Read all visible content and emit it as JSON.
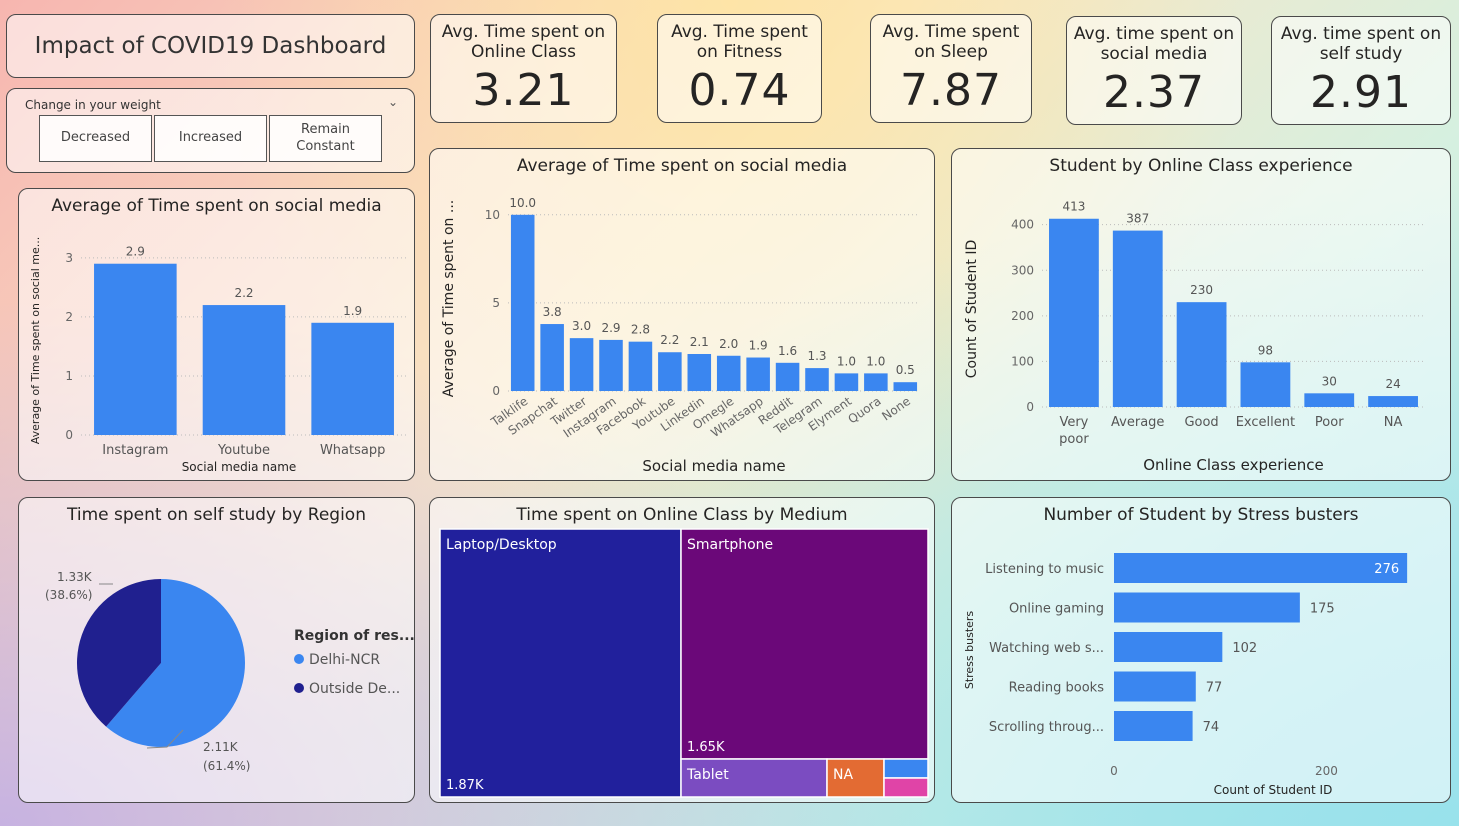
{
  "dashboard_title": "Impact of COVID19 Dashboard",
  "slicer": {
    "title": "Change in your weight",
    "options": [
      "Decreased",
      "Increased",
      "Remain Constant"
    ]
  },
  "cards": [
    {
      "label": "Avg. Time spent on Online Class",
      "value": "3.21"
    },
    {
      "label": "Avg. Time spent on Fitness",
      "value": "0.74"
    },
    {
      "label": "Avg. Time spent on Sleep",
      "value": "7.87"
    },
    {
      "label": "Avg. time spent on social media",
      "value": "2.37"
    },
    {
      "label": "Avg. time spent on self study",
      "value": "2.91"
    }
  ],
  "colors": {
    "bar": "#3A86F0",
    "pie_light": "#3A86F0",
    "pie_dark": "#20208F",
    "laptop": "#21209C",
    "smartphone": "#6B0879",
    "tablet": "#7B4CC1",
    "na": "#E36B33",
    "other1": "#3A86F0",
    "other2": "#E044A7"
  },
  "chart_data": [
    {
      "type": "bar",
      "title": "Average of Time spent on social media",
      "xlabel": "Social media name",
      "ylabel": "Average of Time spent on social me...",
      "categories": [
        "Instagram",
        "Youtube",
        "Whatsapp"
      ],
      "values": [
        2.9,
        2.2,
        1.9
      ],
      "data_labels": [
        "2.9",
        "2.2",
        "1.9"
      ],
      "yticks": [
        "0",
        "1",
        "2",
        "3"
      ],
      "ylim": [
        0,
        3.2
      ],
      "grid": true
    },
    {
      "type": "bar",
      "title": "Average of Time spent on social media",
      "xlabel": "Social media name",
      "ylabel": "Average of Time spent on ...",
      "categories": [
        "Talklife",
        "Snapchat",
        "Twitter",
        "Instagram",
        "Facebook",
        "Youtube",
        "Linkedin",
        "Omegle",
        "Whatsapp",
        "Reddit",
        "Telegram",
        "Elyment",
        "Quora",
        "None"
      ],
      "values": [
        10.0,
        3.8,
        3.0,
        2.9,
        2.8,
        2.2,
        2.1,
        2.0,
        1.9,
        1.6,
        1.3,
        1.0,
        1.0,
        0.5
      ],
      "data_labels": [
        "10.0",
        "3.8",
        "3.0",
        "2.9",
        "2.8",
        "2.2",
        "2.1",
        "2.0",
        "1.9",
        "1.6",
        "1.3",
        "1.0",
        "1.0",
        "0.5"
      ],
      "yticks": [
        "0",
        "5",
        "10"
      ],
      "ylim": [
        0,
        10.5
      ],
      "grid": true
    },
    {
      "type": "bar",
      "title": "Student by Online Class experience",
      "xlabel": "Online Class experience",
      "ylabel": "Count of Student ID",
      "categories": [
        "Very poor",
        "Average",
        "Good",
        "Excellent",
        "Poor",
        "NA"
      ],
      "values": [
        413,
        387,
        230,
        98,
        30,
        24
      ],
      "data_labels": [
        "413",
        "387",
        "230",
        "98",
        "30",
        "24"
      ],
      "yticks": [
        "0",
        "100",
        "200",
        "300",
        "400"
      ],
      "ylim": [
        0,
        430
      ],
      "grid": true
    },
    {
      "type": "pie",
      "title": "Time spent on self study by Region",
      "legend_title": "Region of res...",
      "legend_position": "right",
      "categories": [
        "Delhi-NCR",
        "Outside De..."
      ],
      "values": [
        2110,
        1330
      ],
      "percent": [
        61.4,
        38.6
      ],
      "data_labels": [
        [
          "2.11K",
          "(61.4%)"
        ],
        [
          "1.33K",
          "(38.6%)"
        ]
      ]
    },
    {
      "type": "treemap",
      "title": "Time spent on Online Class by Medium",
      "categories": [
        "Laptop/Desktop",
        "Smartphone",
        "Tablet",
        "NA"
      ],
      "data_labels": [
        "1.87K",
        "1.65K"
      ],
      "values": [
        1870,
        1650,
        null,
        null
      ]
    },
    {
      "type": "bar",
      "orientation": "horizontal",
      "title": "Number of Student by Stress busters",
      "xlabel": "Count of Student ID",
      "ylabel": "Stress busters",
      "categories": [
        "Listening to music",
        "Online gaming",
        "Watching web s...",
        "Reading books",
        "Scrolling throug..."
      ],
      "values": [
        276,
        175,
        102,
        77,
        74
      ],
      "data_labels": [
        "276",
        "175",
        "102",
        "77",
        "74"
      ],
      "xticks": [
        "0",
        "200"
      ],
      "xlim": [
        0,
        290
      ]
    }
  ]
}
